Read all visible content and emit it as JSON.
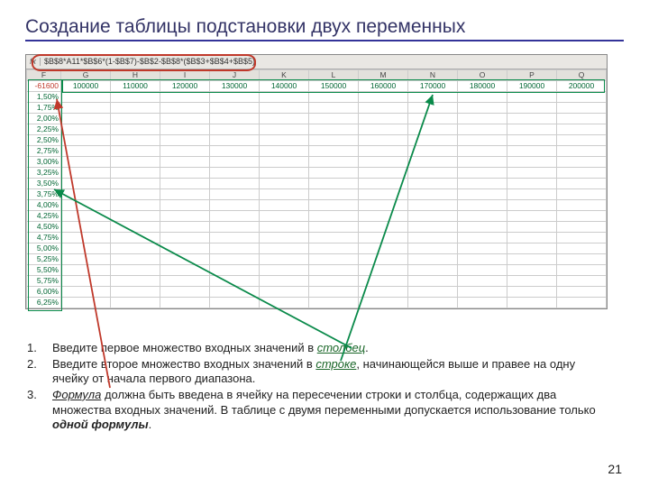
{
  "title": "Создание таблицы подстановки двух переменных",
  "formula_bar": {
    "fx": "fx",
    "text": "$B$8*A11*$B$6*(1-$B$7)-$B$2-$B$8*($B$3+$B$4+$B$5)"
  },
  "columns": [
    "F",
    "G",
    "H",
    "I",
    "J",
    "K",
    "L",
    "M",
    "N",
    "O",
    "P",
    "Q"
  ],
  "corner_value": "-61600",
  "row_values": [
    "100000",
    "110000",
    "120000",
    "130000",
    "140000",
    "150000",
    "160000",
    "170000",
    "180000",
    "190000",
    "200000"
  ],
  "col_percents": [
    "1,50%",
    "1,75%",
    "2,00%",
    "2,25%",
    "2,50%",
    "2,75%",
    "3,00%",
    "3,25%",
    "3,50%",
    "3,75%",
    "4,00%",
    "4,25%",
    "4,50%",
    "4,75%",
    "5,00%",
    "5,25%",
    "5,50%",
    "5,75%",
    "6,00%",
    "6,25%"
  ],
  "list": {
    "n1": "1.",
    "n2": "2.",
    "n3": "3.",
    "t1a": " Введите первое множество входных значений в ",
    "t1b": "столбец",
    "t1c": ".",
    "t2a": " Введите второе множество входных значений в ",
    "t2b": "строке",
    "t2c": ", начинающейся выше и правее на одну ячейку от начала первого диапазона.",
    "t3a": " ",
    "t3b": "Формула",
    "t3c": " должна быть введена в ячейку на пересечении строки и столбца, содержащих два множества входных значений. В таблице с двумя переменными допускается использование только ",
    "t3d": "одной формулы",
    "t3e": "."
  },
  "page_number": "21"
}
